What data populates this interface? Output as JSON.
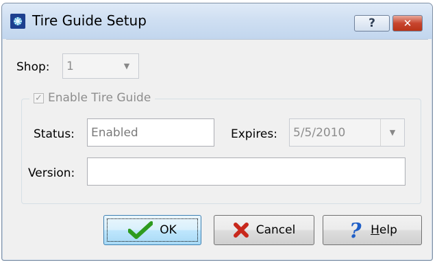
{
  "window": {
    "title": "Tire Guide Setup",
    "help_button": "?",
    "close_button": "✕"
  },
  "shop": {
    "label": "Shop:",
    "value": "1"
  },
  "enable": {
    "label": "Enable Tire Guide",
    "checked": true
  },
  "status": {
    "label": "Status:",
    "value": "Enabled"
  },
  "expires": {
    "label": "Expires:",
    "value": "5/5/2010"
  },
  "version": {
    "label": "Version:",
    "value": ""
  },
  "buttons": {
    "ok": {
      "label": "OK",
      "accent": "#2e9b1f"
    },
    "cancel": {
      "label": "Cancel",
      "accent": "#c8281c"
    },
    "help": {
      "label_underlined": "H",
      "label_rest": "elp",
      "accent": "#1f5fc7"
    }
  }
}
